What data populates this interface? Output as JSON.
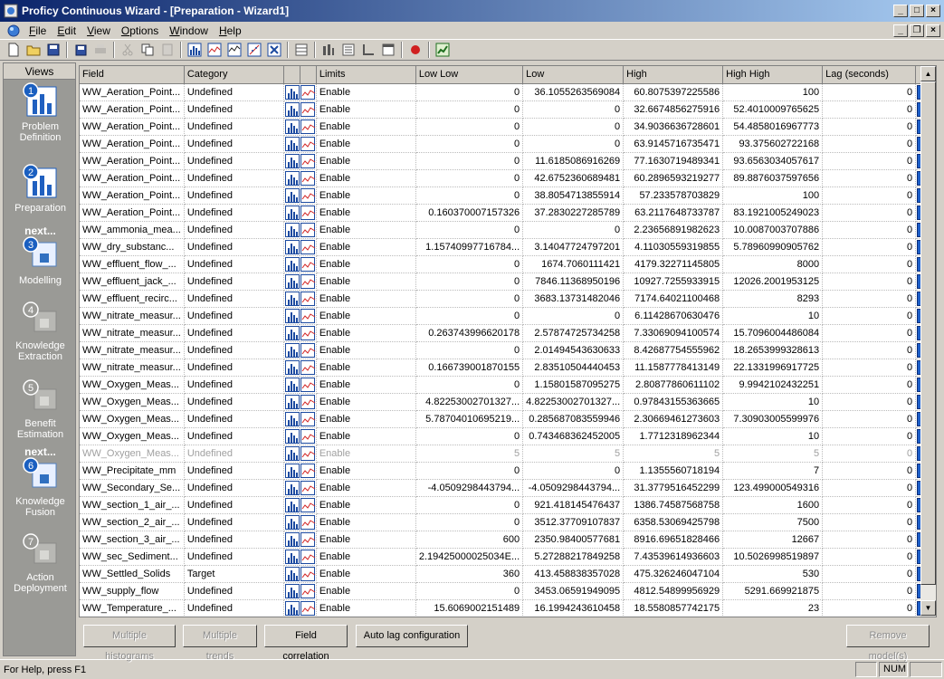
{
  "window": {
    "title": "Proficy Continuous Wizard - [Preparation - Wizard1]"
  },
  "menu": [
    {
      "label": "File",
      "u": "F",
      "rest": "ile"
    },
    {
      "label": "Edit",
      "u": "E",
      "rest": "dit"
    },
    {
      "label": "View",
      "u": "V",
      "rest": "iew"
    },
    {
      "label": "Options",
      "u": "O",
      "rest": "ptions"
    },
    {
      "label": "Window",
      "u": "W",
      "rest": "indow"
    },
    {
      "label": "Help",
      "u": "H",
      "rest": "elp"
    }
  ],
  "views": {
    "header": "Views",
    "items": [
      {
        "num": "1",
        "label1": "Problem",
        "label2": "Definition",
        "next": false
      },
      {
        "num": "2",
        "label1": "Preparation",
        "label2": "",
        "next": false
      },
      {
        "num": "3",
        "label1": "Modelling",
        "label2": "",
        "next": true,
        "next_label": "next..."
      },
      {
        "num": "4",
        "label1": "Knowledge",
        "label2": "Extraction",
        "next": false
      },
      {
        "num": "5",
        "label1": "Benefit",
        "label2": "Estimation",
        "next": false
      },
      {
        "num": "6",
        "label1": "Knowledge",
        "label2": "Fusion",
        "next": true,
        "next_label": "next..."
      },
      {
        "num": "7",
        "label1": "Action",
        "label2": "Deployment",
        "next": false
      }
    ]
  },
  "grid": {
    "columns": [
      "Field",
      "Category",
      "",
      "",
      "Limits",
      "Low Low",
      "Low",
      "High",
      "High High",
      "Lag (seconds)",
      ""
    ],
    "rows": [
      [
        "WW_Aeration_Point...",
        "Undefined",
        "Enable",
        "0",
        "36.1055263569084",
        "60.8075397225586",
        "100",
        "0",
        ""
      ],
      [
        "WW_Aeration_Point...",
        "Undefined",
        "Enable",
        "0",
        "0",
        "32.6674856275916",
        "52.4010009765625",
        "0",
        ""
      ],
      [
        "WW_Aeration_Point...",
        "Undefined",
        "Enable",
        "0",
        "0",
        "34.9036636728601",
        "54.4858016967773",
        "0",
        ""
      ],
      [
        "WW_Aeration_Point...",
        "Undefined",
        "Enable",
        "0",
        "0",
        "63.9145716735471",
        "93.375602722168",
        "0",
        ""
      ],
      [
        "WW_Aeration_Point...",
        "Undefined",
        "Enable",
        "0",
        "11.6185086916269",
        "77.1630719489341",
        "93.6563034057617",
        "0",
        ""
      ],
      [
        "WW_Aeration_Point...",
        "Undefined",
        "Enable",
        "0",
        "42.6752360689481",
        "60.2896593219277",
        "89.8876037597656",
        "0",
        ""
      ],
      [
        "WW_Aeration_Point...",
        "Undefined",
        "Enable",
        "0",
        "38.8054713855914",
        "57.233578703829",
        "100",
        "0",
        ""
      ],
      [
        "WW_Aeration_Point...",
        "Undefined",
        "Enable",
        "0.160370007157326",
        "37.2830227285789",
        "63.2117648733787",
        "83.1921005249023",
        "0",
        ""
      ],
      [
        "WW_ammonia_mea...",
        "Undefined",
        "Enable",
        "0",
        "0",
        "2.23656891982623",
        "10.0087003707886",
        "0",
        ""
      ],
      [
        "WW_dry_substanc...",
        "Undefined",
        "Enable",
        "1.15740997716784...",
        "3.14047724797201",
        "4.11030559319855",
        "5.78960990905762",
        "0",
        ""
      ],
      [
        "WW_effluent_flow_...",
        "Undefined",
        "Enable",
        "0",
        "1674.7060111421",
        "4179.32271145805",
        "8000",
        "0",
        ""
      ],
      [
        "WW_effluent_jack_...",
        "Undefined",
        "Enable",
        "0",
        "7846.11368950196",
        "10927.7255933915",
        "12026.2001953125",
        "0",
        ""
      ],
      [
        "WW_effluent_recirc...",
        "Undefined",
        "Enable",
        "0",
        "3683.13731482046",
        "7174.64021100468",
        "8293",
        "0",
        ""
      ],
      [
        "WW_nitrate_measur...",
        "Undefined",
        "Enable",
        "0",
        "0",
        "6.11428670630476",
        "10",
        "0",
        ""
      ],
      [
        "WW_nitrate_measur...",
        "Undefined",
        "Enable",
        "0.263743996620178",
        "2.57874725734258",
        "7.33069094100574",
        "15.7096004486084",
        "0",
        ""
      ],
      [
        "WW_nitrate_measur...",
        "Undefined",
        "Enable",
        "0",
        "2.01494543630633",
        "8.42687754555962",
        "18.2653999328613",
        "0",
        ""
      ],
      [
        "WW_nitrate_measur...",
        "Undefined",
        "Enable",
        "0.166739001870155",
        "2.83510504440453",
        "11.1587778413149",
        "22.1331996917725",
        "0",
        ""
      ],
      [
        "WW_Oxygen_Meas...",
        "Undefined",
        "Enable",
        "0",
        "1.15801587095275",
        "2.80877860611102",
        "9.9942102432251",
        "0",
        ""
      ],
      [
        "WW_Oxygen_Meas...",
        "Undefined",
        "Enable",
        "4.82253002701327...",
        "4.82253002701327...",
        "0.97843155363665",
        "10",
        "0",
        ""
      ],
      [
        "WW_Oxygen_Meas...",
        "Undefined",
        "Enable",
        "5.78704010695219...",
        "0.285687083559946",
        "2.30669461273603",
        "7.30903005599976",
        "0",
        ""
      ],
      [
        "WW_Oxygen_Meas...",
        "Undefined",
        "Enable",
        "0",
        "0.743468362452005",
        "1.7712318962344",
        "10",
        "0",
        ""
      ],
      [
        "WW_Oxygen_Meas...",
        "Undefined",
        "Enable",
        "5",
        "5",
        "5",
        "5",
        "0",
        "disabled"
      ],
      [
        "WW_Precipitate_mm",
        "Undefined",
        "Enable",
        "0",
        "0",
        "1.1355560718194",
        "7",
        "0",
        ""
      ],
      [
        "WW_Secondary_Se...",
        "Undefined",
        "Enable",
        "-4.0509298443794...",
        "-4.0509298443794...",
        "31.3779516452299",
        "123.499000549316",
        "0",
        ""
      ],
      [
        "WW_section_1_air_...",
        "Undefined",
        "Enable",
        "0",
        "921.418145476437",
        "1386.74587568758",
        "1600",
        "0",
        ""
      ],
      [
        "WW_section_2_air_...",
        "Undefined",
        "Enable",
        "0",
        "3512.37709107837",
        "6358.53069425798",
        "7500",
        "0",
        ""
      ],
      [
        "WW_section_3_air_...",
        "Undefined",
        "Enable",
        "600",
        "2350.98400577681",
        "8916.69651828466",
        "12667",
        "0",
        ""
      ],
      [
        "WW_sec_Sediment...",
        "Undefined",
        "Enable",
        "2.19425000025034E...",
        "5.27288217849258",
        "7.43539614936603",
        "10.5026998519897",
        "0",
        ""
      ],
      [
        "WW_Settled_Solids",
        "Target",
        "Enable",
        "360",
        "413.458838357028",
        "475.326246047104",
        "530",
        "0",
        ""
      ],
      [
        "WW_supply_flow",
        "Undefined",
        "Enable",
        "0",
        "3453.06591949095",
        "4812.54899956929",
        "5291.669921875",
        "0",
        ""
      ],
      [
        "WW_Temperature_...",
        "Undefined",
        "Enable",
        "15.6069002151489",
        "16.1994243610458",
        "18.5580857742175",
        "23",
        "0",
        ""
      ]
    ]
  },
  "buttons": {
    "multiple_histograms": "Multiple histograms",
    "multiple_trends": "Multiple trends",
    "field_correlation": "Field correlation",
    "auto_lag": "Auto lag configuration",
    "remove_models": "Remove model(s)"
  },
  "status": {
    "help": "For Help, press F1",
    "num": "NUM"
  }
}
